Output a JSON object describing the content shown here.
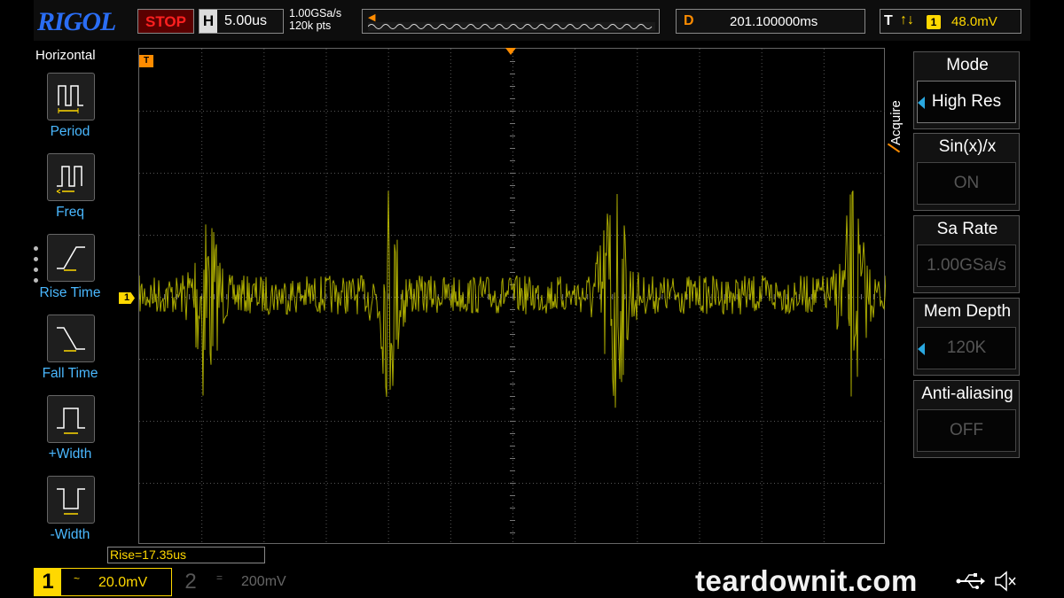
{
  "header": {
    "logo": "RIGOL",
    "run_state": "STOP",
    "horizontal": {
      "letter": "H",
      "timebase": "5.00us"
    },
    "sample": {
      "rate": "1.00GSa/s",
      "points": "120k pts"
    },
    "delay": {
      "letter": "D",
      "value": "201.100000ms"
    },
    "trigger": {
      "letter": "T",
      "edge_icon": "rise-fall-edge",
      "channel": "1",
      "level": "48.0mV"
    }
  },
  "left_menu": {
    "title": "Horizontal",
    "items": [
      {
        "label": "Period",
        "icon": "period-icon"
      },
      {
        "label": "Freq",
        "icon": "freq-icon"
      },
      {
        "label": "Rise Time",
        "icon": "rise-time-icon"
      },
      {
        "label": "Fall Time",
        "icon": "fall-time-icon"
      },
      {
        "label": "+Width",
        "icon": "pos-width-icon"
      },
      {
        "label": "-Width",
        "icon": "neg-width-icon"
      }
    ]
  },
  "markers": {
    "ch1": "1",
    "trigger_pos": "T"
  },
  "right_menu": {
    "tab": "Acquire",
    "items": [
      {
        "title": "Mode",
        "value": "High Res",
        "active": true,
        "arrow": true
      },
      {
        "title": "Sin(x)/x",
        "value": "ON",
        "active": false,
        "arrow": false
      },
      {
        "title": "Sa Rate",
        "value": "1.00GSa/s",
        "active": false,
        "arrow": false
      },
      {
        "title": "Mem Depth",
        "value": "120K",
        "active": false,
        "arrow": true
      },
      {
        "title": "Anti-aliasing",
        "value": "OFF",
        "active": false,
        "arrow": false
      }
    ]
  },
  "measurement": {
    "text": "Rise=17.35us"
  },
  "channels": {
    "ch1": {
      "num": "1",
      "coupling": "~",
      "scale": "20.0mV"
    },
    "ch2": {
      "num": "2",
      "coupling": "=",
      "scale": "200mV"
    }
  },
  "watermark": "teardownit.com",
  "colors": {
    "ch1": "#ffd800",
    "trace": "#c8c800",
    "trigger": "#ff8c00",
    "menu_label": "#4ab8ff",
    "stop": "#ff2020",
    "logo": "#2a6df4"
  }
}
